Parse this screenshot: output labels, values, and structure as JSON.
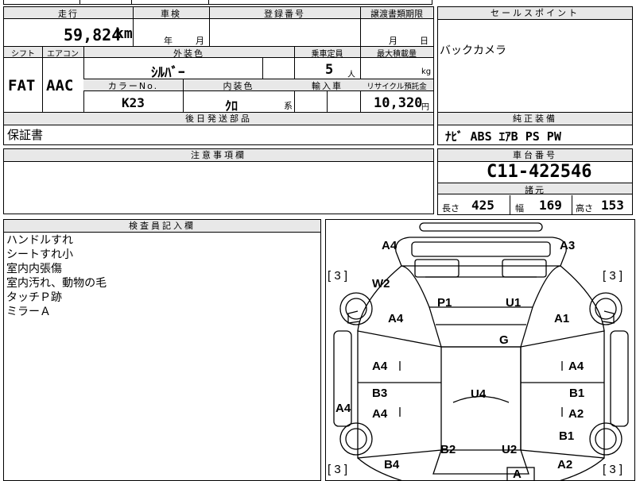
{
  "top_strip": {
    "text1": "",
    "text2": ""
  },
  "row1": {
    "mileage_label": "走行",
    "mileage_value": "59,824",
    "mileage_unit": "km",
    "shaken_label": "車検",
    "shaken_year": "年",
    "shaken_month": "月",
    "reg_label": "登録番号",
    "transfer_label": "譲渡書類期限",
    "transfer_month": "月",
    "transfer_day": "日"
  },
  "row2": {
    "shift_label": "シフト",
    "shift_value": "FAT",
    "ac_label": "エアコン",
    "ac_value": "AAC",
    "exterior_label": "外装色",
    "exterior_value": "ｼﾙﾊﾞｰ",
    "seats_label": "乗車定員",
    "seats_value": "5",
    "seats_unit": "人",
    "load_label": "最大積載量",
    "load_unit": "kg",
    "color_no_label": "カラーNo.",
    "color_no_value": "K23",
    "interior_label": "内装色",
    "interior_value": "ｸﾛ",
    "interior_suffix": "系",
    "import_label": "輸入車",
    "recycle_label": "リサイクル預託金",
    "recycle_value": "10,320",
    "recycle_unit": "円"
  },
  "later_parts": {
    "label": "後日発送部品",
    "value": "保証書"
  },
  "caution": {
    "label": "注意事項欄"
  },
  "sales": {
    "label": "セールスポイント",
    "value": "バックカメラ"
  },
  "equipment": {
    "label": "純正装備",
    "value": "ﾅﾋﾞ ABS ｴｱB PS PW"
  },
  "chassis": {
    "label": "車台番号",
    "value": "C11-422546"
  },
  "specs": {
    "label": "諸元",
    "length_label": "長さ",
    "length_value": "425",
    "width_label": "幅",
    "width_value": "169",
    "height_label": "高さ",
    "height_value": "153"
  },
  "inspector": {
    "label": "検査員記入欄",
    "lines": [
      "ハンドルすれ",
      "シートすれ小",
      "室内内張傷",
      "室内汚れ、動物の毛",
      "タッチＰ跡",
      "ミラーＡ"
    ]
  },
  "diagram": {
    "marks": {
      "a4_tl": "A4",
      "a3_tr": "A3",
      "w2": "W2",
      "p1": "P1",
      "u1": "U1",
      "a4_l": "A4",
      "a1_r": "A1",
      "g": "G",
      "a4_ml": "A4",
      "a4_mr": "A4",
      "b3": "B3",
      "b1_r": "B1",
      "a4_ll": "A4",
      "a4_lm": "A4",
      "u4": "U4",
      "a2_r": "A2",
      "b1_br": "B1",
      "b2": "B2",
      "u2": "U2",
      "b4": "B4",
      "a2_br": "A2",
      "a_bottom": "A"
    },
    "brackets": {
      "tl": "[ 3 ]",
      "tr": "[ 3 ]",
      "bl": "[ 3 ]",
      "br": "[ 3 ]"
    }
  }
}
